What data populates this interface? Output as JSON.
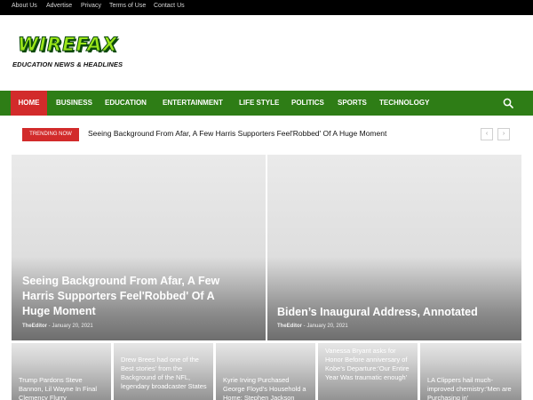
{
  "topbar": {
    "links": [
      "About Us",
      "Advertise",
      "Privacy",
      "Terms of Use",
      "Contact Us"
    ]
  },
  "logo": {
    "main": "WIREFAX",
    "tagline": "EDUCATION NEWS & HEADLINES"
  },
  "nav": {
    "items": [
      "HOME",
      "BUSINESS",
      "EDUCATION",
      "ENTERTAINMENT",
      "LIFE STYLE",
      "POLITICS",
      "SPORTS",
      "TECHNOLOGY"
    ],
    "search_icon": "search-icon"
  },
  "trending": {
    "badge": "TRENDING NOW",
    "headline": "Seeing Background From Afar, A Few Harris Supporters Feel'Robbed' Of A Huge Moment",
    "prev_icon": "chevron-left-icon",
    "next_icon": "chevron-right-icon"
  },
  "featured": [
    {
      "title": "Seeing Background From Afar, A Few Harris Supporters Feel'Robbed' Of A Huge Moment",
      "author": "TheEditor",
      "separator": "-",
      "date": "January 20, 2021"
    },
    {
      "title": "Biden’s Inaugural Address, Annotated",
      "author": "TheEditor",
      "separator": "-",
      "date": "January 20, 2021"
    }
  ],
  "cards": [
    "Trump Pardons Steve Bannon, Lil Wayne In Final Clemency Flurry",
    "Drew Brees had one of the Best stories' from the Background of the NFL, legendary broadcaster States",
    "Kyrie Irving Purchased George Floyd’s Household a Home: Stephen Jackson",
    "Vanessa Bryant asks for Honor Before anniversary of Kobe’s Departure:'Our Entire Year Was traumatic enough'",
    "LA Clippers hail much-improved chemistry:'Men are Purchasing in'"
  ],
  "colors": {
    "topbar": "#000000",
    "nav": "#2e7d16",
    "accent_red": "#d22b2b",
    "logo_green": "#9be61a"
  }
}
